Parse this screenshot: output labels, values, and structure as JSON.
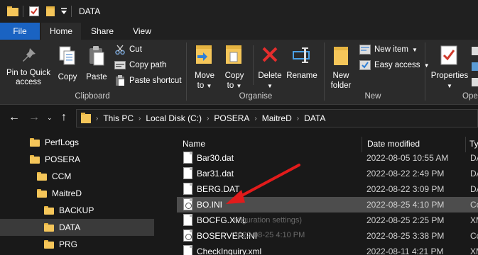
{
  "window": {
    "title": "DATA"
  },
  "tabs": [
    {
      "label": "File"
    },
    {
      "label": "Home"
    },
    {
      "label": "Share"
    },
    {
      "label": "View"
    }
  ],
  "ribbon": {
    "clipboard": {
      "group_label": "Clipboard",
      "pin_label_1": "Pin to Quick",
      "pin_label_2": "access",
      "copy_label": "Copy",
      "paste_label": "Paste",
      "cut_label": "Cut",
      "copy_path_label": "Copy path",
      "paste_shortcut_label": "Paste shortcut"
    },
    "organise": {
      "group_label": "Organise",
      "move_to_label_1": "Move",
      "move_to_label_2": "to",
      "copy_to_label_1": "Copy",
      "copy_to_label_2": "to",
      "delete_label": "Delete",
      "rename_label": "Rename"
    },
    "new": {
      "group_label": "New",
      "new_folder_label_1": "New",
      "new_folder_label_2": "folder",
      "new_item_label": "New item",
      "easy_access_label": "Easy access"
    },
    "open": {
      "group_label": "Ope",
      "properties_label": "Properties"
    }
  },
  "address": {
    "crumbs": [
      "This PC",
      "Local Disk (C:)",
      "POSERA",
      "MaitreD",
      "DATA"
    ]
  },
  "nav_tree": [
    {
      "label": "PerfLogs"
    },
    {
      "label": "POSERA"
    },
    {
      "label": "CCM"
    },
    {
      "label": "MaitreD"
    },
    {
      "label": "BACKUP"
    },
    {
      "label": "DATA"
    },
    {
      "label": "PRG"
    }
  ],
  "columns": {
    "name": "Name",
    "date": "Date modified",
    "type": "Ty"
  },
  "files": [
    {
      "name": "Bar30.dat",
      "date": "2022-08-05 10:55 AM",
      "type": "DA"
    },
    {
      "name": "Bar31.dat",
      "date": "2022-08-22 2:49 PM",
      "type": "DA"
    },
    {
      "name": "BERG.DAT",
      "date": "2022-08-22 3:09 PM",
      "type": "DA"
    },
    {
      "name": "BO.INI",
      "date": "2022-08-25 4:10 PM",
      "type": "Co"
    },
    {
      "name": "BOCFG.XML",
      "date": "2022-08-25 2:25 PM",
      "type": "XM"
    },
    {
      "name": "BOSERVER.INI",
      "date": "2022-08-25 3:38 PM",
      "type": "Co"
    },
    {
      "name": "CheckInquiry.xml",
      "date": "2022-08-11 4:21 PM",
      "type": "XM"
    }
  ],
  "ghost_tooltip": {
    "line1": "nfiguration settings)",
    "line2": "2022-08-25 4:10 PM"
  },
  "colors": {
    "file_tab": "#1a63c2",
    "folder": "#f5c65a",
    "annotation_arrow": "#e21b1b",
    "selection": "#4d4d4d"
  }
}
